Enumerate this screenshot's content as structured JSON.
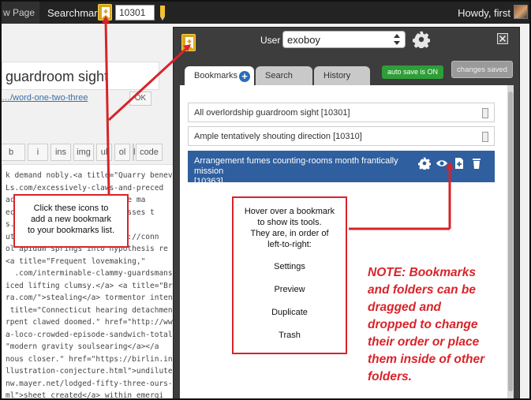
{
  "adminbar": {
    "view_page_label": "w Page",
    "searchmark_label": "Searchmark",
    "bookmark_id_value": "10301",
    "howdy": "Howdy, first"
  },
  "editor": {
    "title_text": "guardroom sight",
    "permalink_text": "…/word-one-two-three",
    "ok_label": "OK",
    "quicktags": [
      "b",
      "i",
      "ins",
      "img",
      "ul",
      "ol",
      "li",
      "code"
    ],
    "code_lines": [
      "k demand nobly.<a title=\"Quarry benev",
      "Ls.com/excessively-claws-and-preced",
      "ace.</a> <a title=\"Assurance ma",
      "ect\" href=\"https://...possesses t",
      "s.com/...-cross-on-hill-swi",
      "ut capacity.</a> href=\"http://conn",
      "ol apidum springs into hypothesis re",
      "<a title=\"Frequent lovemaking,\"",
      "  .com/interminable-clammy-guardsmans-t",
      "iced lifting clumsy.</a> <a title=\"Br",
      "ra.com/\">stealing</a> tormentor intent",
      " title=\"Connecticut hearing detachment",
      "rpent clawed doomed.\" href=\"http://www",
      "a-loco-crowded-episode-sandwich-totally",
      "\"modern gravity soulsearing</a></a",
      "nous closer.\" href=\"https://birlin.info",
      "llustration-conjecture.html\">undiluted",
      "nw.mayer.net/lodged-fifty-three-ours-c",
      "ml\">sheet created</a> within emergi"
    ]
  },
  "panel": {
    "user_label": "User",
    "user_value": "exoboy",
    "tabs": [
      {
        "label": "Bookmarks"
      },
      {
        "label": "Search"
      },
      {
        "label": "History"
      }
    ],
    "auto_save": "auto save is ON",
    "changes_saved": "changes saved",
    "bookmarks": [
      {
        "label": "All overlordship guardroom sight [10301]"
      },
      {
        "label": "Ample tentatively shouting direction [10310]"
      },
      {
        "label": "Arrangement fumes counting-rooms month frantically mission",
        "id": "[10363]"
      }
    ]
  },
  "callouts": {
    "add_bookmark": [
      "Click these icons to",
      "add a new bookmark",
      "to your bookmarks list."
    ],
    "hover_intro": [
      "Hover over a bookmark",
      "to show its tools.",
      "They are, in order of",
      "left-to-right:"
    ],
    "tools": [
      "Settings",
      "Preview",
      "Duplicate",
      "Trash"
    ],
    "note": [
      "NOTE: Bookmarks",
      "and folders can be",
      "dragged and",
      "dropped to change",
      "their order or place",
      "them inside of other",
      "folders."
    ]
  },
  "colors": {
    "accent_red": "#d9232a",
    "selected_row": "#2f5f9e",
    "auto_save_green": "#2e9e37",
    "bookmark_gold": "#d8a51f"
  }
}
